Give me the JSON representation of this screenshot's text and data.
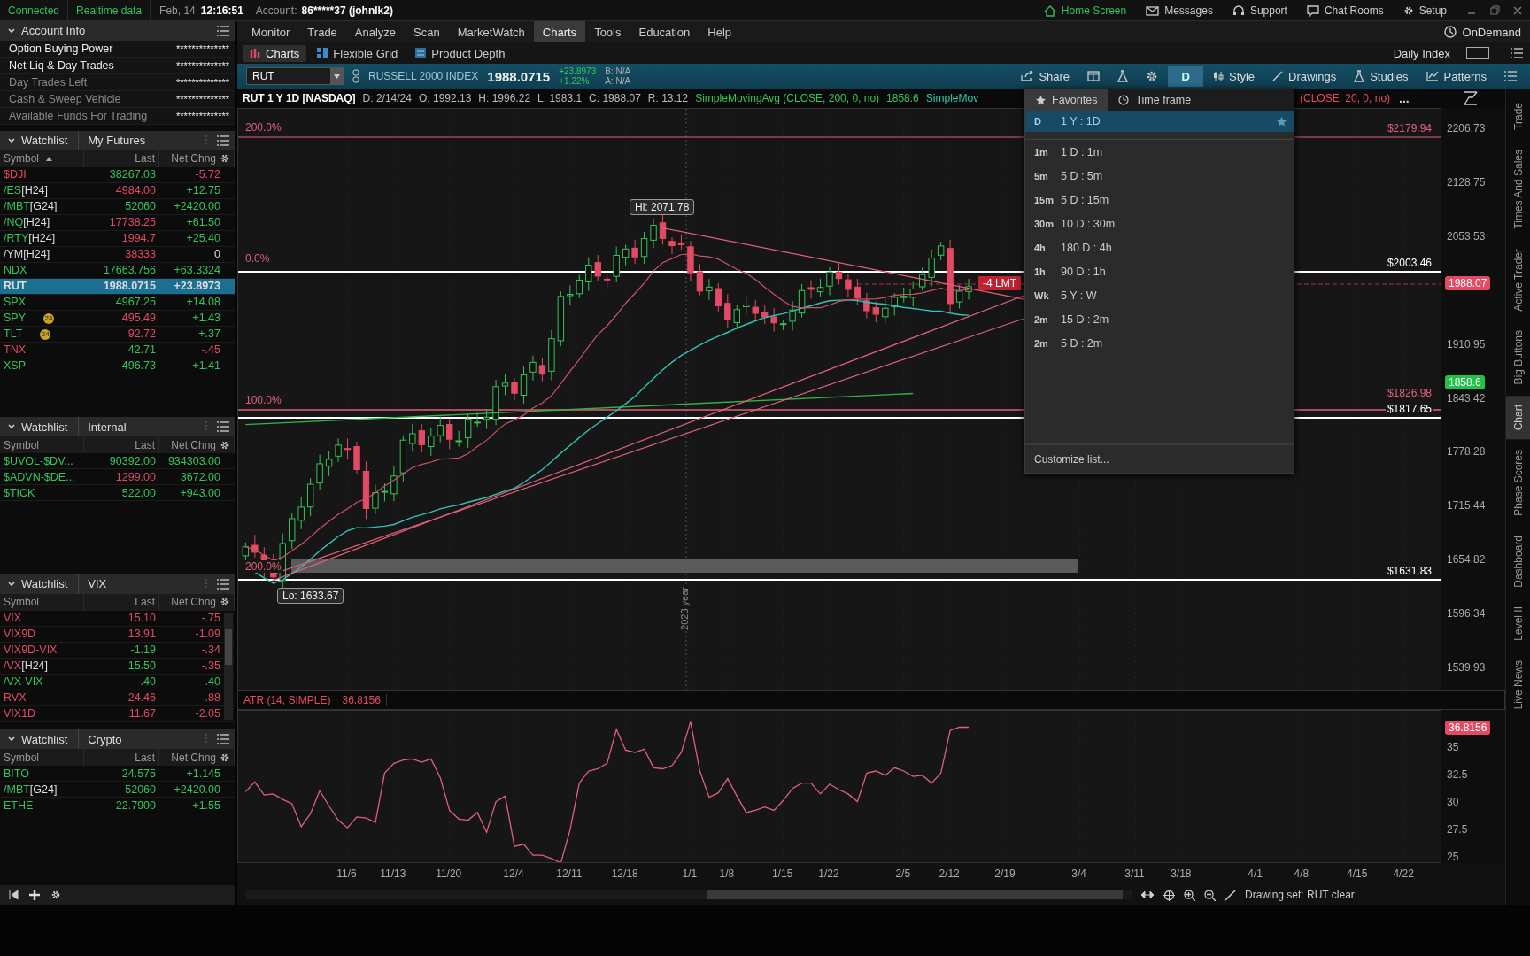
{
  "status_bar": {
    "connection": "Connected",
    "data_mode": "Realtime data",
    "date": "Feb, 14",
    "time": "12:16:51",
    "account_label": "Account:",
    "account": "86*****37 (johnlk2)"
  },
  "top_links": [
    {
      "kind": "home",
      "label": "Home Screen",
      "selected": true
    },
    {
      "kind": "mail",
      "label": "Messages",
      "selected": false
    },
    {
      "kind": "support",
      "label": "Support",
      "selected": false
    },
    {
      "kind": "chat",
      "label": "Chat Rooms",
      "selected": false
    },
    {
      "kind": "gear",
      "label": "Setup",
      "selected": false
    }
  ],
  "menu": [
    {
      "label": "Monitor",
      "selected": false
    },
    {
      "label": "Trade",
      "selected": false
    },
    {
      "label": "Analyze",
      "selected": false
    },
    {
      "label": "Scan",
      "selected": false
    },
    {
      "label": "MarketWatch",
      "selected": false
    },
    {
      "label": "Charts",
      "selected": true
    },
    {
      "label": "Tools",
      "selected": false
    },
    {
      "label": "Education",
      "selected": false
    },
    {
      "label": "Help",
      "selected": false
    }
  ],
  "ondemand": "OnDemand",
  "chart_tabs": [
    {
      "kind": "charts",
      "label": "Charts",
      "selected": true
    },
    {
      "kind": "grid",
      "label": "Flexible Grid",
      "selected": false
    },
    {
      "kind": "depth",
      "label": "Product Depth",
      "selected": false
    }
  ],
  "daily_index": "Daily Index",
  "account_info": {
    "title": "Account Info",
    "expanded": true,
    "rows": [
      {
        "label": "Option Buying Power",
        "kind": "selectable",
        "value": "**************"
      },
      {
        "label": "Net Liq & Day Trades",
        "kind": "selectable",
        "value": "**************"
      },
      {
        "label": "Day Trades Left",
        "kind": "plain",
        "value": "**************"
      },
      {
        "label": "Cash & Sweep Vehicle",
        "kind": "plain",
        "value": "**************"
      },
      {
        "label": "Available Funds For Trading",
        "kind": "plain",
        "value": "**************"
      }
    ]
  },
  "watchlists": [
    {
      "title": "Watchlist",
      "name": "My Futures",
      "expanded": true,
      "sorted_ascending": true,
      "columns": [
        "Symbol",
        "Last",
        "Net Chng"
      ],
      "scrollbar": false,
      "rows": [
        {
          "symbol": {
            "text": "$DJI",
            "color": "#e34a63"
          },
          "last": {
            "text": "38267.03",
            "color": "#35c45a"
          },
          "change": {
            "text": "-5.72",
            "color": "#e34a63"
          },
          "selected": false
        },
        {
          "symbol": {
            "text": "/ES",
            "color": "#35c45a"
          },
          "contract": "[H24]",
          "last": {
            "text": "4984.00",
            "color": "#e34a63"
          },
          "change": {
            "text": "+12.75",
            "color": "#35c45a"
          },
          "selected": false
        },
        {
          "symbol": {
            "text": "/MBT",
            "color": "#35c45a"
          },
          "contract": "[G24]",
          "last": {
            "text": "52060",
            "color": "#35c45a"
          },
          "change": {
            "text": "+2420.00",
            "color": "#35c45a"
          },
          "selected": false
        },
        {
          "symbol": {
            "text": "/NQ",
            "color": "#35c45a"
          },
          "contract": "[H24]",
          "last": {
            "text": "17738.25",
            "color": "#e34a63"
          },
          "change": {
            "text": "+61.50",
            "color": "#35c45a"
          },
          "selected": false
        },
        {
          "symbol": {
            "text": "/RTY",
            "color": "#35c45a"
          },
          "contract": "[H24]",
          "last": {
            "text": "1994.7",
            "color": "#e34a63"
          },
          "change": {
            "text": "+25.40",
            "color": "#35c45a"
          },
          "selected": false
        },
        {
          "symbol": {
            "text": "/YM"
          },
          "contract": "[H24]",
          "last": {
            "text": "38333",
            "color": "#e34a63"
          },
          "change": {
            "text": "0"
          },
          "selected": false
        },
        {
          "symbol": {
            "text": "NDX",
            "color": "#35c45a"
          },
          "last": {
            "text": "17663.756",
            "color": "#35c45a"
          },
          "change": {
            "text": "+63.3324",
            "color": "#35c45a"
          },
          "selected": false
        },
        {
          "symbol": {
            "text": "RUT"
          },
          "last": {
            "text": "1988.0715"
          },
          "change": {
            "text": "+23.8973"
          },
          "selected": true
        },
        {
          "symbol": {
            "text": "SPX",
            "color": "#35c45a"
          },
          "last": {
            "text": "4967.25",
            "color": "#35c45a"
          },
          "change": {
            "text": "+14.08",
            "color": "#35c45a"
          },
          "selected": false
        },
        {
          "symbol": {
            "text": "SPY",
            "color": "#35c45a"
          },
          "badge": "24",
          "last": {
            "text": "495.49",
            "color": "#e34a63"
          },
          "change": {
            "text": "+1.43",
            "color": "#35c45a"
          },
          "selected": false
        },
        {
          "symbol": {
            "text": "TLT",
            "color": "#35c45a"
          },
          "badge": "24",
          "last": {
            "text": "92.72",
            "color": "#e34a63"
          },
          "change": {
            "text": "+.37",
            "color": "#35c45a"
          },
          "selected": false
        },
        {
          "symbol": {
            "text": "TNX",
            "color": "#e34a63"
          },
          "last": {
            "text": "42.71",
            "color": "#35c45a"
          },
          "change": {
            "text": "-.45",
            "color": "#e34a63"
          },
          "selected": false
        },
        {
          "symbol": {
            "text": "XSP",
            "color": "#35c45a"
          },
          "last": {
            "text": "496.73",
            "color": "#35c45a"
          },
          "change": {
            "text": "+1.41",
            "color": "#35c45a"
          },
          "selected": false
        }
      ]
    },
    {
      "title": "Watchlist",
      "name": "Internal",
      "expanded": true,
      "sorted_ascending": false,
      "columns": [
        "Symbol",
        "Last",
        "Net Chng"
      ],
      "scrollbar": false,
      "rows": [
        {
          "symbol": {
            "text": "$UVOL-$DV...",
            "color": "#35c45a"
          },
          "last": {
            "text": "90392.00",
            "color": "#35c45a"
          },
          "change": {
            "text": "934303.00",
            "color": "#35c45a"
          },
          "selected": false
        },
        {
          "symbol": {
            "text": "$ADVN-$DE...",
            "color": "#35c45a"
          },
          "last": {
            "text": "1299.00",
            "color": "#e34a63"
          },
          "change": {
            "text": "3672.00",
            "color": "#35c45a"
          },
          "selected": false
        },
        {
          "symbol": {
            "text": "$TICK",
            "color": "#35c45a"
          },
          "last": {
            "text": "522.00",
            "color": "#35c45a"
          },
          "change": {
            "text": "+943.00",
            "color": "#35c45a"
          },
          "selected": false
        }
      ]
    },
    {
      "title": "Watchlist",
      "name": "VIX",
      "expanded": true,
      "sorted_ascending": false,
      "columns": [
        "Symbol",
        "Last",
        "Net Chng"
      ],
      "scrollbar": true,
      "rows": [
        {
          "symbol": {
            "text": "VIX",
            "color": "#e34a63"
          },
          "last": {
            "text": "15.10",
            "color": "#e34a63"
          },
          "change": {
            "text": "-.75",
            "color": "#e34a63"
          },
          "selected": false
        },
        {
          "symbol": {
            "text": "VIX9D",
            "color": "#e34a63"
          },
          "last": {
            "text": "13.91",
            "color": "#e34a63"
          },
          "change": {
            "text": "-1.09",
            "color": "#e34a63"
          },
          "selected": false
        },
        {
          "symbol": {
            "text": "VIX9D-VIX",
            "color": "#e34a63"
          },
          "last": {
            "text": "-1.19",
            "color": "#35c45a"
          },
          "change": {
            "text": "-.34",
            "color": "#e34a63"
          },
          "selected": false
        },
        {
          "symbol": {
            "text": "/VX",
            "color": "#e34a63"
          },
          "contract": "[H24]",
          "last": {
            "text": "15.50",
            "color": "#35c45a"
          },
          "change": {
            "text": "-.35",
            "color": "#e34a63"
          },
          "selected": false
        },
        {
          "symbol": {
            "text": "/VX-VIX",
            "color": "#35c45a"
          },
          "last": {
            "text": ".40",
            "color": "#35c45a"
          },
          "change": {
            "text": ".40",
            "color": "#35c45a"
          },
          "selected": false
        },
        {
          "symbol": {
            "text": "RVX",
            "color": "#e34a63"
          },
          "last": {
            "text": "24.46",
            "color": "#e34a63"
          },
          "change": {
            "text": "-.88",
            "color": "#e34a63"
          },
          "selected": false
        },
        {
          "symbol": {
            "text": "VIX1D",
            "color": "#e34a63"
          },
          "last": {
            "text": "11.67",
            "color": "#e34a63"
          },
          "change": {
            "text": "-2.05",
            "color": "#e34a63"
          },
          "selected": false
        }
      ]
    },
    {
      "title": "Watchlist",
      "name": "Crypto",
      "expanded": true,
      "sorted_ascending": false,
      "columns": [
        "Symbol",
        "Last",
        "Net Chng"
      ],
      "scrollbar": false,
      "rows": [
        {
          "symbol": {
            "text": "BITO",
            "color": "#35c45a"
          },
          "last": {
            "text": "24.575",
            "color": "#35c45a"
          },
          "change": {
            "text": "+1.145",
            "color": "#35c45a"
          },
          "selected": false
        },
        {
          "symbol": {
            "text": "/MBT",
            "color": "#35c45a"
          },
          "contract": "[G24]",
          "last": {
            "text": "52060",
            "color": "#35c45a"
          },
          "change": {
            "text": "+2420.00",
            "color": "#35c45a"
          },
          "selected": false
        },
        {
          "symbol": {
            "text": "ETHE",
            "color": "#35c45a"
          },
          "last": {
            "text": "22.7900",
            "color": "#35c45a"
          },
          "change": {
            "text": "+1.55",
            "color": "#35c45a"
          },
          "selected": false
        }
      ]
    }
  ],
  "toolbar": {
    "symbol": "RUT",
    "description": "RUSSELL 2000 INDEX",
    "price": "1988.0715",
    "change": "+23.8973",
    "percent": "+1.22%",
    "bid": "B: N/A",
    "ask": "A: N/A",
    "buttons": [
      {
        "kind": "share",
        "label": "Share",
        "pressed": false
      },
      {
        "kind": "grid",
        "pressed": false
      },
      {
        "kind": "flask",
        "pressed": false
      },
      {
        "kind": "gear",
        "pressed": false
      },
      {
        "kind": "timeframe",
        "label": "D",
        "pressed": true
      },
      {
        "kind": "style",
        "label": "Style",
        "pressed": false
      },
      {
        "kind": "drawings",
        "label": "Drawings",
        "pressed": false
      },
      {
        "kind": "studies",
        "label": "Studies",
        "pressed": false
      },
      {
        "kind": "patterns",
        "label": "Patterns",
        "pressed": false
      },
      {
        "kind": "menu",
        "pressed": false
      }
    ]
  },
  "study_header": {
    "left": [
      {
        "text": "RUT 1 Y 1D [NASDAQ]",
        "color": "#ffffff"
      },
      {
        "text": "D: 2/14/24",
        "color": "#bbbbbb"
      },
      {
        "text": "O: 1992.13",
        "color": "#bbbbbb"
      },
      {
        "text": "H: 1996.22",
        "color": "#bbbbbb"
      },
      {
        "text": "L: 1983.1",
        "color": "#bbbbbb"
      },
      {
        "text": "C: 1988.07",
        "color": "#bbbbbb"
      },
      {
        "text": "R: 13.12",
        "color": "#bbbbbb"
      },
      {
        "text": "SimpleMovingAvg (CLOSE, 200, 0, no)",
        "color": "#35c45a"
      },
      {
        "text": "1858.6",
        "color": "#35c45a"
      },
      {
        "text": "SimpleMov",
        "color": "#2ec4b6"
      }
    ],
    "right": [
      {
        "text": "(CLOSE, 20, 0, no)",
        "color": "#e34a63"
      },
      {
        "text": "...",
        "color": "#cccccc"
      }
    ]
  },
  "price_axis": [
    "2206.73",
    "2128.75",
    "2053.53",
    "1910.95",
    "1843.42",
    "1778.28",
    "1715.44",
    "1654.82",
    "1596.34",
    "1539.93"
  ],
  "price_badges": [
    {
      "label": "1988.07",
      "color": "#e34a63"
    },
    {
      "label": "1858.6",
      "color": "#22c24a"
    }
  ],
  "price_levels": [
    {
      "label": "$2179.94",
      "color": "#e0607a"
    },
    {
      "label": "$2003.46",
      "color": "#ffffff"
    },
    {
      "label": "$1826.98",
      "color": "#e0607a"
    },
    {
      "label": "$1817.65",
      "color": "#ffffff"
    },
    {
      "label": "$1631.83",
      "color": "#ffffff"
    }
  ],
  "fib_labels": [
    {
      "label": "200.0%",
      "color": "#e0607a"
    },
    {
      "label": "0.0%",
      "color": "#e0607a"
    },
    {
      "label": "100.0%",
      "color": "#e0607a"
    },
    {
      "label": "200.0%",
      "color": "#e0607a"
    }
  ],
  "hi_label": "Hi: 2071.78",
  "lo_label": "Lo: 1633.67",
  "order_label": "-4 LMT",
  "year_label": "2023 year",
  "timeframe_menu": {
    "tabs": [
      {
        "kind": "star",
        "label": "Favorites",
        "selected": true
      },
      {
        "kind": "clock",
        "label": "Time frame",
        "selected": false
      }
    ],
    "items": [
      {
        "code": "D",
        "label": "1 Y : 1D",
        "selected": true,
        "favorite": true
      },
      {
        "code": "1m",
        "label": "1 D : 1m",
        "selected": false,
        "favorite": false
      },
      {
        "code": "5m",
        "label": "5 D : 5m",
        "selected": false,
        "favorite": false
      },
      {
        "code": "15m",
        "label": "5 D : 15m",
        "selected": false,
        "favorite": false
      },
      {
        "code": "30m",
        "label": "10 D : 30m",
        "selected": false,
        "favorite": false
      },
      {
        "code": "4h",
        "label": "180 D : 4h",
        "selected": false,
        "favorite": false
      },
      {
        "code": "1h",
        "label": "90 D : 1h",
        "selected": false,
        "favorite": false
      },
      {
        "code": "Wk",
        "label": "5 Y : W",
        "selected": false,
        "favorite": false
      },
      {
        "code": "2m",
        "label": "15 D : 2m",
        "selected": false,
        "favorite": false
      },
      {
        "code": "2m",
        "label": "5 D : 2m",
        "selected": false,
        "favorite": false
      }
    ],
    "customize": "Customize list..."
  },
  "atr": {
    "reading": "36.8156",
    "axis_badge": "36.8156",
    "chart_data": {
      "type": "line",
      "categories": [
        null,
        null,
        null,
        null,
        null,
        null,
        null,
        null,
        null,
        null,
        null,
        "11/6",
        null,
        null,
        null,
        null,
        "11/13",
        null,
        null,
        null,
        null,
        null,
        "11/20",
        null,
        null,
        null,
        null,
        null,
        null,
        "12/4",
        null,
        null,
        null,
        null,
        null,
        "12/11",
        null,
        null,
        null,
        null,
        null,
        "12/18",
        null,
        null,
        null,
        null,
        null,
        null,
        "1/1",
        null,
        null,
        null,
        "1/8",
        null,
        null,
        null,
        null,
        null,
        "1/15",
        null,
        null,
        null,
        null,
        "1/22",
        null,
        null,
        null,
        null,
        null,
        null,
        null,
        "2/5",
        null,
        null,
        null,
        null,
        "2/12",
        null,
        null,
        null,
        null,
        null,
        "2/19",
        null,
        null,
        null,
        null,
        null,
        null,
        null,
        "3/4",
        null,
        null,
        null,
        null,
        null,
        "3/11",
        null,
        null,
        null,
        null,
        "3/18",
        null,
        null,
        null,
        null,
        null,
        null,
        null,
        "4/1",
        null,
        null,
        null,
        null,
        "4/8",
        null,
        null,
        null,
        null,
        null,
        "4/15",
        null,
        null,
        null,
        null,
        "4/22",
        null,
        null,
        null
      ],
      "series": [
        {
          "name": "ATR (14, SIMPLE)",
          "color": "#e0607a",
          "values": [
            31.0,
            31.9,
            30.7,
            30.8,
            30.3,
            29.9,
            27.8,
            29.0,
            31.1,
            29.7,
            28.4,
            27.7,
            28.7,
            28.6,
            28.2,
            32.7,
            33.6,
            33.9,
            34.0,
            33.7,
            34.0,
            32.3,
            29.3,
            28.5,
            28.4,
            29.1,
            27.3,
            30.1,
            30.6,
            26.0,
            26.2,
            25.2,
            25.2,
            24.9,
            24.5,
            27.5,
            31.8,
            32.9,
            33.1,
            33.6,
            36.7,
            34.8,
            34.6,
            34.9,
            33.2,
            33.1,
            33.4,
            34.6,
            37.4,
            32.9,
            30.5,
            30.9,
            32.2,
            30.6,
            29.1,
            29.3,
            29.6,
            29.3,
            30.2,
            31.3,
            31.8,
            31.8,
            30.8,
            31.7,
            31.2,
            30.8,
            30.1,
            32.7,
            32.9,
            32.5,
            33.2,
            32.9,
            32.4,
            32.5,
            31.8,
            32.7,
            36.6,
            36.9,
            36.9,
            null,
            null,
            null,
            null,
            null,
            null,
            null,
            null,
            null,
            null,
            null,
            null,
            null,
            null,
            null,
            null,
            null,
            null,
            null,
            null,
            null,
            null,
            null,
            null,
            null,
            null,
            null,
            null,
            null,
            null,
            null,
            null,
            null,
            null,
            null,
            null,
            null,
            null,
            null,
            null,
            null,
            null,
            null,
            null,
            null,
            null,
            null,
            null,
            null,
            null
          ]
        }
      ],
      "ylim": [
        24.4,
        38.4
      ],
      "yticks": [
        25,
        27.5,
        30,
        32.5,
        35
      ]
    }
  },
  "drawing_set": "Drawing set: RUT clear",
  "side_tabs": [
    {
      "label": "Trade",
      "selected": false
    },
    {
      "label": "Times And Sales",
      "selected": false
    },
    {
      "label": "Active Trader",
      "selected": false
    },
    {
      "label": "Big Buttons",
      "selected": false
    },
    {
      "label": "Chart",
      "selected": true
    },
    {
      "label": "Phase Scores",
      "selected": false
    },
    {
      "label": "Dashboard",
      "selected": false
    },
    {
      "label": "Level II",
      "selected": false
    },
    {
      "label": "Live News",
      "selected": false
    }
  ]
}
